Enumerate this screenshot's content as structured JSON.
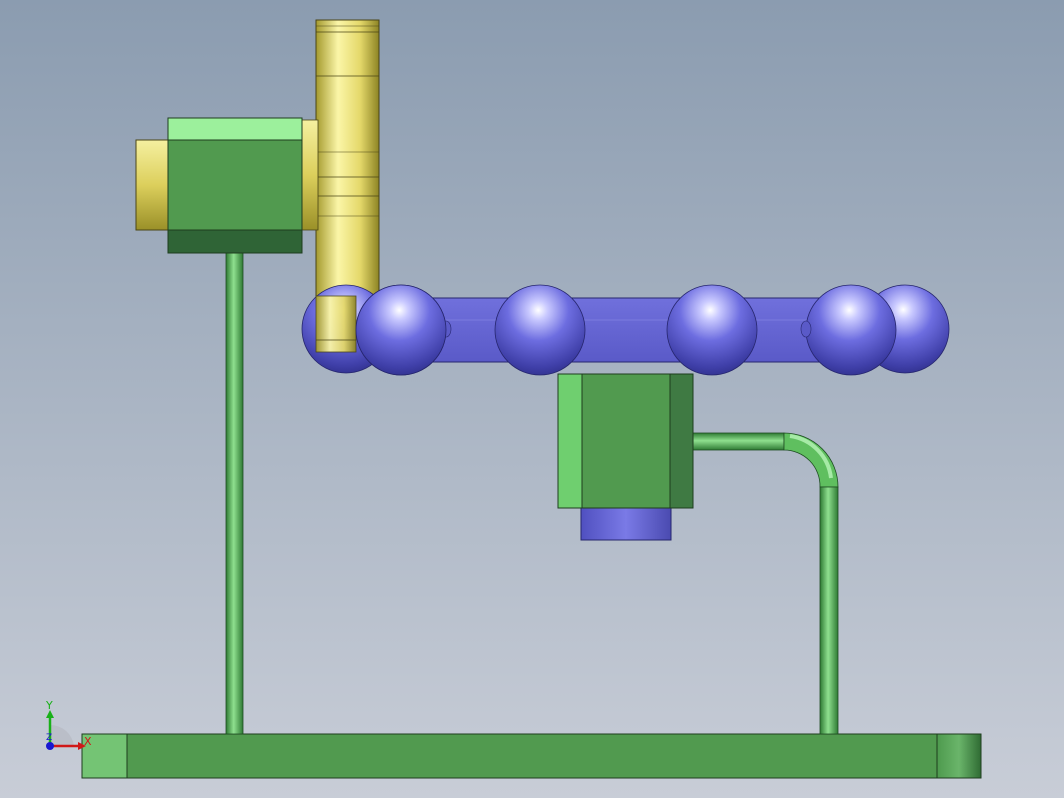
{
  "viewport": {
    "background_top": "#8b9cb0",
    "background_bottom": "#c7ccd6"
  },
  "colors": {
    "green": "#4e9a4e",
    "green_light": "#7fd47f",
    "green_dark": "#2f6b33",
    "gold": "#e3d76a",
    "purple": "#6a6ad8",
    "purple_dark": "#4a4ab0",
    "axis_x": "#d01818",
    "axis_y": "#18b018",
    "axis_z": "#1818d0"
  },
  "triad": {
    "x_label": "X",
    "y_label": "Y",
    "z_label": "Z"
  },
  "model_parts": [
    "base-plate-icon",
    "left-support-rod-icon",
    "bent-support-rod-icon",
    "pinion-gear-icon",
    "motor-housing-icon",
    "ball-chain-icon",
    "carrier-block-icon"
  ]
}
